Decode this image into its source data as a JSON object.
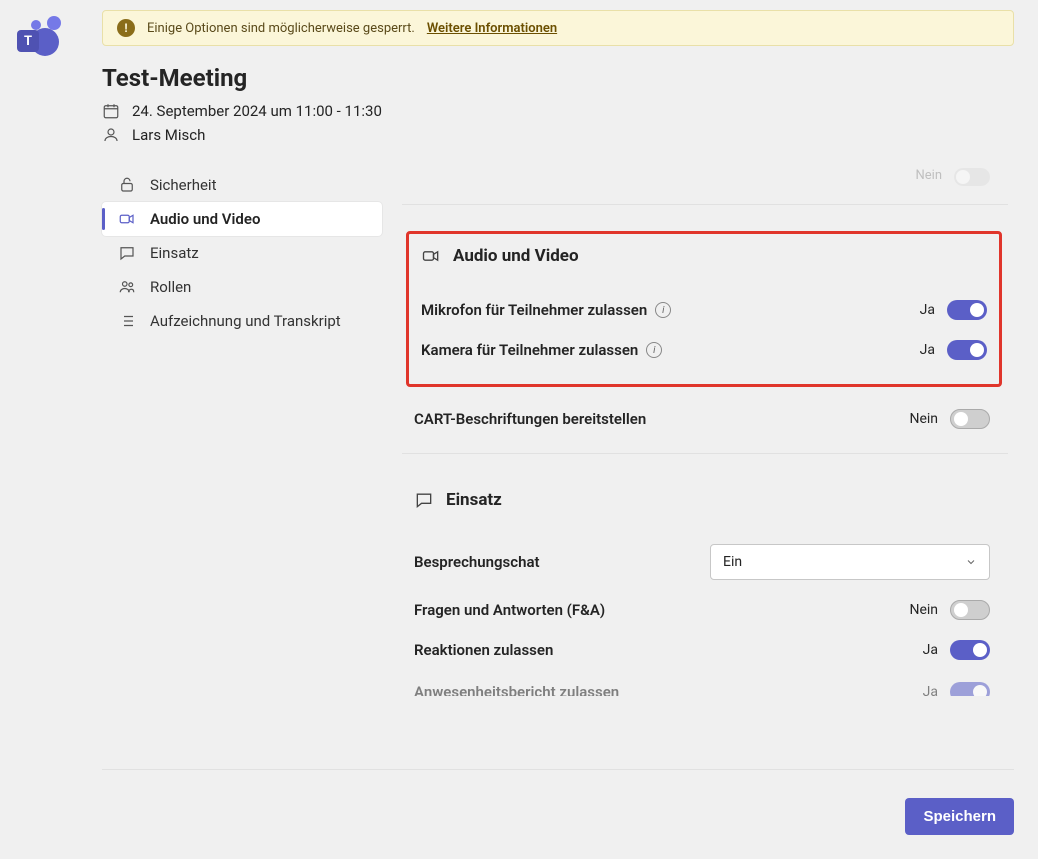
{
  "rail": {
    "logo_letter": "T"
  },
  "banner": {
    "text": "Einige Optionen sind möglicherweise gesperrt.",
    "link": "Weitere Informationen"
  },
  "header": {
    "title": "Test-Meeting",
    "datetime": "24. September 2024 um 11:00 - 11:30",
    "organizer": "Lars Misch"
  },
  "sidebar": {
    "items": [
      {
        "label": "Sicherheit"
      },
      {
        "label": "Audio und Video"
      },
      {
        "label": "Einsatz"
      },
      {
        "label": "Rollen"
      },
      {
        "label": "Aufzeichnung und Transkript"
      }
    ],
    "active_index": 1
  },
  "stub": {
    "label": "Nein"
  },
  "audio_video": {
    "heading": "Audio und Video",
    "mic": {
      "label": "Mikrofon für Teilnehmer zulassen",
      "state_text": "Ja",
      "on": true
    },
    "cam": {
      "label": "Kamera für Teilnehmer zulassen",
      "state_text": "Ja",
      "on": true
    },
    "cart": {
      "label": "CART-Beschriftungen bereitstellen",
      "state_text": "Nein",
      "on": false
    }
  },
  "engagement": {
    "heading": "Einsatz",
    "chat": {
      "label": "Besprechungschat",
      "value": "Ein"
    },
    "qa": {
      "label": "Fragen und Antworten (F&A)",
      "state_text": "Nein",
      "on": false
    },
    "reactions": {
      "label": "Reaktionen zulassen",
      "state_text": "Ja",
      "on": true
    },
    "attendance_partial": {
      "label": "Anwesenheitsbericht zulassen",
      "state_text": "Ja"
    }
  },
  "footer": {
    "save": "Speichern"
  }
}
